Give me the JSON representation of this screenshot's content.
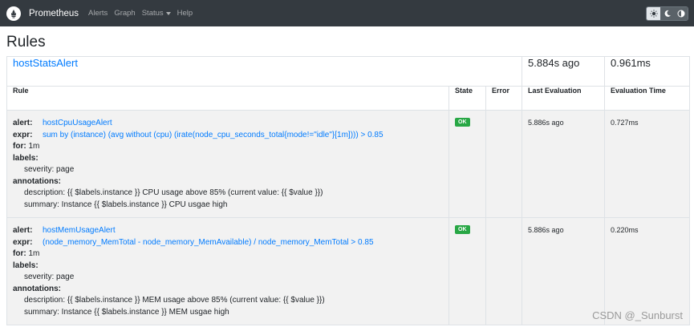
{
  "navbar": {
    "brand": "Prometheus",
    "items": [
      "Alerts",
      "Graph",
      "Status",
      "Help"
    ]
  },
  "page_title": "Rules",
  "group": {
    "name": "hostStatsAlert",
    "last_evaluation": "5.884s ago",
    "evaluation_time": "0.961ms"
  },
  "columns": [
    "Rule",
    "State",
    "Error",
    "Last Evaluation",
    "Evaluation Time"
  ],
  "rules": [
    {
      "alert_key": "alert:",
      "alert": "hostCpuUsageAlert",
      "expr_key": "expr:",
      "expr": "sum by (instance) (avg without (cpu) (irate(node_cpu_seconds_total{mode!=\"idle\"}[1m]))) > 0.85",
      "for_key": "for:",
      "for": "1m",
      "labels_key": "labels:",
      "severity": "severity: page",
      "annotations_key": "annotations:",
      "description": "description: {{ $labels.instance }} CPU usage above 85% (current value: {{ $value }})",
      "summary": "summary: Instance {{ $labels.instance }} CPU usgae high",
      "state": "OK",
      "error": "",
      "last_evaluation": "5.886s ago",
      "evaluation_time": "0.727ms"
    },
    {
      "alert_key": "alert:",
      "alert": "hostMemUsageAlert",
      "expr_key": "expr:",
      "expr": "(node_memory_MemTotal - node_memory_MemAvailable) / node_memory_MemTotal > 0.85",
      "for_key": "for:",
      "for": "1m",
      "labels_key": "labels:",
      "severity": "severity: page",
      "annotations_key": "annotations:",
      "description": "description: {{ $labels.instance }} MEM usage above 85% (current value: {{ $value }})",
      "summary": "summary: Instance {{ $labels.instance }} MEM usgae high",
      "state": "OK",
      "error": "",
      "last_evaluation": "5.886s ago",
      "evaluation_time": "0.220ms"
    }
  ],
  "watermark": "CSDN @_Sunburst",
  "icons": [
    "prometheus-logo-icon",
    "sun-icon",
    "moon-icon",
    "half-circle-icon",
    "caret-down-icon"
  ],
  "colors": {
    "link": "#007bff",
    "ok": "#28a745",
    "navbar": "#343a40",
    "row": "#f2f2f2"
  }
}
